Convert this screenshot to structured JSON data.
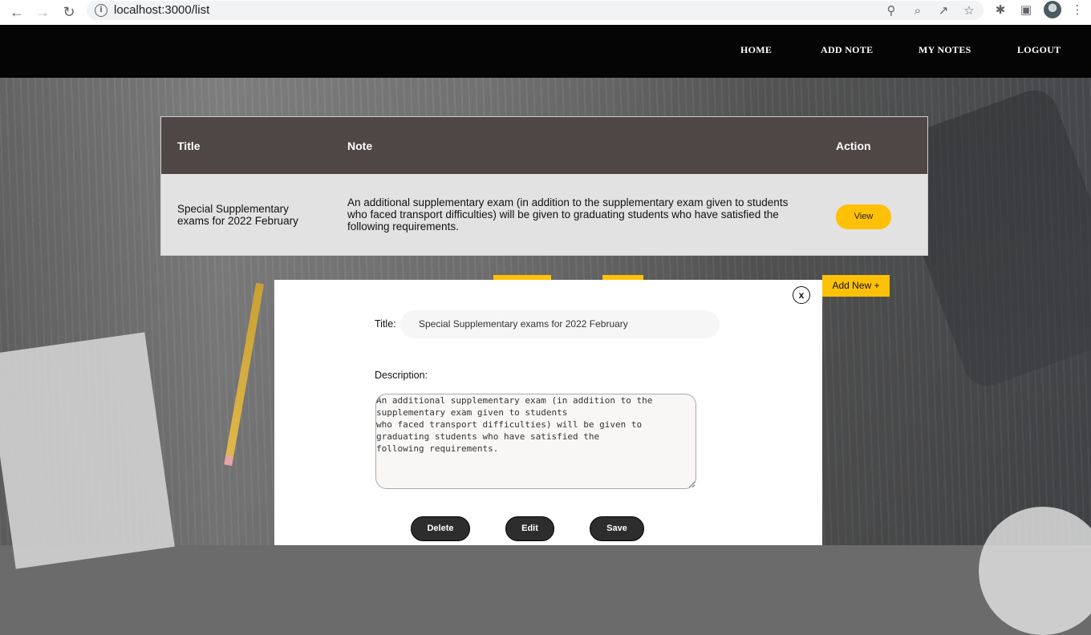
{
  "browser": {
    "url": "localhost:3000/list",
    "icons": [
      "back-icon",
      "forward-icon",
      "reload-icon",
      "info-icon",
      "key-icon",
      "zoom-icon",
      "share-icon",
      "star-icon",
      "extensions-icon",
      "sidepanel-icon",
      "profile-avatar",
      "menu-icon"
    ]
  },
  "nav": {
    "items": [
      {
        "label": "HOME"
      },
      {
        "label": "ADD NOTE"
      },
      {
        "label": "MY NOTES"
      },
      {
        "label": "LOGOUT"
      }
    ]
  },
  "table": {
    "headers": {
      "title": "Title",
      "note": "Note",
      "action": "Action"
    },
    "rows": [
      {
        "title": "Special Supplementary exams for 2022 February",
        "note": "An additional supplementary exam (in addition to the supplementary exam given to students who faced transport difficulties) will be given to graduating students who have satisfied the following requirements.",
        "action_label": "View"
      }
    ]
  },
  "add_new_label": "Add New +",
  "modal": {
    "close_label": "x",
    "title_label": "Title:",
    "title_value": "Special Supplementary exams for 2022 February",
    "description_label": "Description:",
    "description_value": "An additional supplementary exam (in addition to the\nsupplementary exam given to students\nwho faced transport difficulties) will be given to\ngraduating students who have satisfied the\nfollowing requirements.",
    "buttons": {
      "delete": "Delete",
      "edit": "Edit",
      "save": "Save"
    }
  },
  "colors": {
    "nav_bg": "#050505",
    "table_header_bg": "#4f4646",
    "table_row_bg": "#e2e2e2",
    "accent_yellow": "#ffc107",
    "modal_button_bg": "#2d2d2d"
  }
}
